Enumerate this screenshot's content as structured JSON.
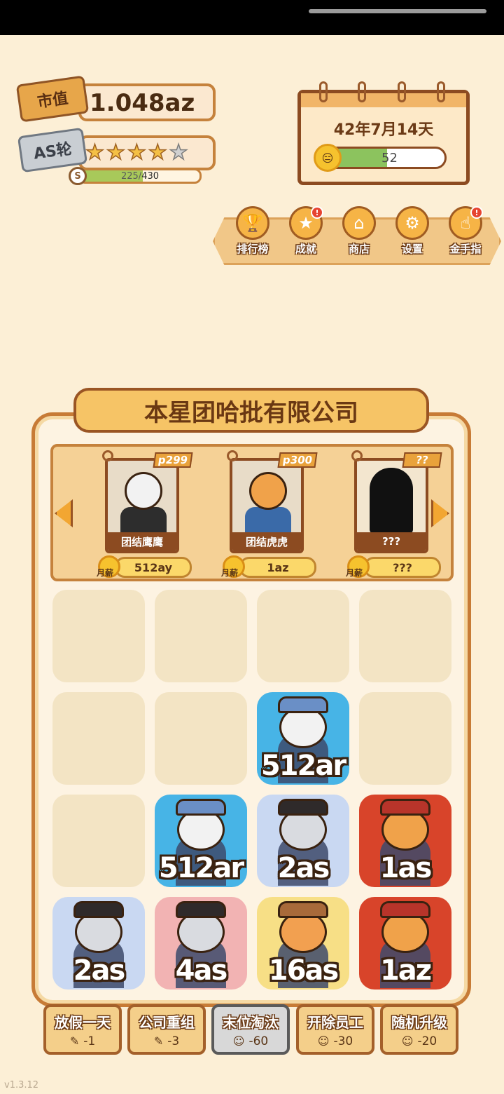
{
  "stats": {
    "market_value_label": "市值",
    "market_value": "1.048az",
    "round_label": "AS轮",
    "stars_filled": 4,
    "stars_total": 5,
    "xp_current": "225",
    "xp_sep": "/",
    "xp_max": "430",
    "xp_progress": 0.523,
    "coin_symbol": "S"
  },
  "calendar": {
    "date": "42年7月14天",
    "mood_value": "52",
    "mood_progress": 0.52
  },
  "menu": [
    {
      "label": "排行榜",
      "icon": "trophy-icon",
      "glyph": "🏆",
      "badge": false
    },
    {
      "label": "成就",
      "icon": "medal-icon",
      "glyph": "★",
      "badge": true
    },
    {
      "label": "商店",
      "icon": "shop-icon",
      "glyph": "⌂",
      "badge": false
    },
    {
      "label": "设置",
      "icon": "gear-icon",
      "glyph": "⚙",
      "badge": false
    },
    {
      "label": "金手指",
      "icon": "pointer-hand-icon",
      "glyph": "☝",
      "badge": true
    }
  ],
  "badge_mark": "!",
  "company": {
    "name": "本星团哈批有限公司"
  },
  "roster": {
    "salary_label": "月薪",
    "cards": [
      {
        "level": "p299",
        "name": "团结鹰鹰",
        "salary": "512ay",
        "bg": "#e8dcc8"
      },
      {
        "level": "p300",
        "name": "团结虎虎",
        "salary": "1az",
        "bg": "#e8dcc8"
      },
      {
        "level": "??",
        "name": "???",
        "salary": "???",
        "bg": "#f3e6cf"
      }
    ]
  },
  "grid": {
    "rows": [
      [
        null,
        null,
        null,
        null
      ],
      [
        null,
        null,
        {
          "value": "512ar",
          "bg": "#47b4e6",
          "char": "eagle"
        },
        null
      ],
      [
        null,
        {
          "value": "512ar",
          "bg": "#47b4e6",
          "char": "eagle"
        },
        {
          "value": "2as",
          "bg": "#c9d8f2",
          "char": "cat"
        },
        {
          "value": "1as",
          "bg": "#d8442a",
          "char": "tiger"
        }
      ],
      [
        {
          "value": "2as",
          "bg": "#c9d8f2",
          "char": "cat"
        },
        {
          "value": "4as",
          "bg": "#f2b3b3",
          "char": "cat"
        },
        {
          "value": "16as",
          "bg": "#f7df86",
          "char": "orange-cat"
        },
        {
          "value": "1az",
          "bg": "#d8442a",
          "char": "tiger"
        }
      ]
    ]
  },
  "actions": [
    {
      "name": "放假一天",
      "cost": "-1",
      "cost_icon": "feather-icon",
      "glyph": "✎",
      "selected": false
    },
    {
      "name": "公司重组",
      "cost": "-3",
      "cost_icon": "feather-icon",
      "glyph": "✎",
      "selected": false
    },
    {
      "name": "末位淘汰",
      "cost": "-60",
      "cost_icon": "smile-icon",
      "glyph": "☺",
      "selected": true
    },
    {
      "name": "开除员工",
      "cost": "-30",
      "cost_icon": "smile-icon",
      "glyph": "☺",
      "selected": false
    },
    {
      "name": "随机升级",
      "cost": "-20",
      "cost_icon": "smile-icon",
      "glyph": "☺",
      "selected": false
    }
  ],
  "version": "v1.3.12",
  "colors": {
    "accent": "#c77b36",
    "mood_fill": "#8cc35e",
    "xp_fill": "#a8c95a"
  }
}
